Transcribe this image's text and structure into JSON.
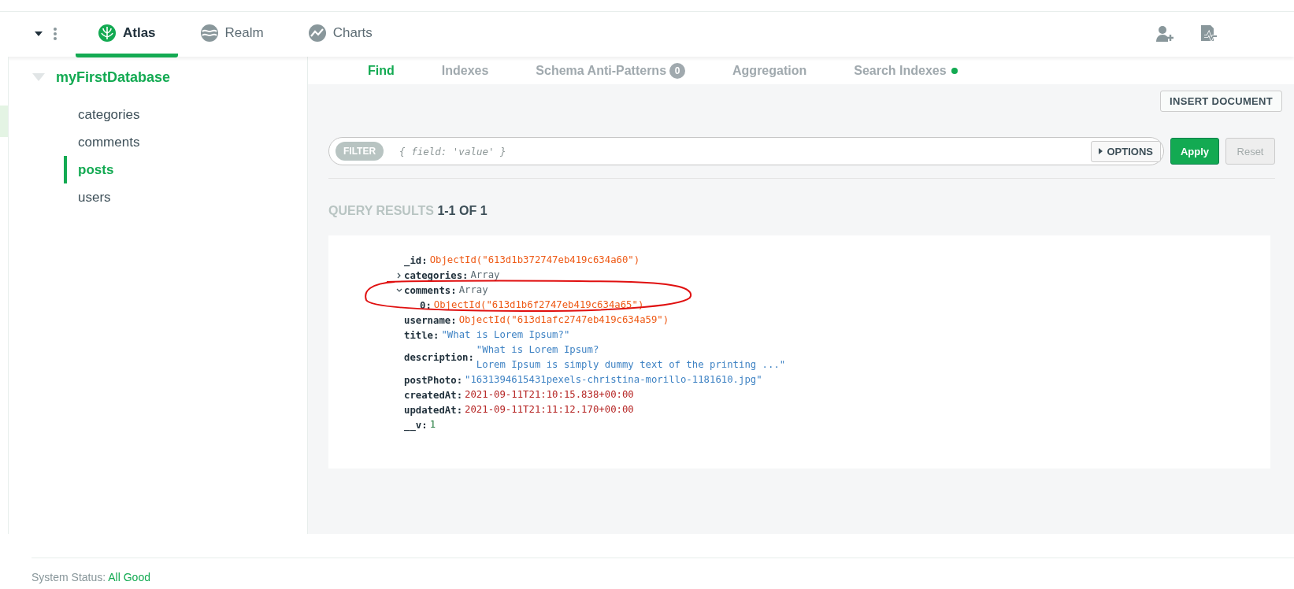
{
  "top_nav": {
    "tabs": [
      {
        "label": "Atlas",
        "selected": true
      },
      {
        "label": "Realm",
        "selected": false
      },
      {
        "label": "Charts",
        "selected": false
      }
    ]
  },
  "sidebar": {
    "database": {
      "name": "myFirstDatabase",
      "expanded": true
    },
    "collections": [
      {
        "label": "categories",
        "selected": false
      },
      {
        "label": "comments",
        "selected": false
      },
      {
        "label": "posts",
        "selected": true
      },
      {
        "label": "users",
        "selected": false
      }
    ]
  },
  "collection_tabs": [
    {
      "label": "Find",
      "selected": true
    },
    {
      "label": "Indexes",
      "selected": false
    },
    {
      "label": "Schema Anti-Patterns",
      "selected": false,
      "count": "0"
    },
    {
      "label": "Aggregation",
      "selected": false
    },
    {
      "label": "Search Indexes",
      "selected": false,
      "color": "#13aa52"
    }
  ],
  "insert_button": "INSERT DOCUMENT",
  "filter": {
    "label": "FILTER",
    "placeholder": "{ field: 'value' }",
    "options": "OPTIONS",
    "apply": "Apply",
    "reset": "Reset",
    "reset_disabled": true
  },
  "results": {
    "label": "QUERY RESULTS",
    "range": "1-1 OF 1"
  },
  "document": {
    "fields": [
      {
        "key": "_id:",
        "kind": "objectid",
        "value": "ObjectId(\"613d1b372747eb419c634a60\")"
      },
      {
        "key": "categories:",
        "kind": "array",
        "value": "Array",
        "expanded": false
      },
      {
        "key": "comments:",
        "kind": "array",
        "value": "Array",
        "expanded": true,
        "children": [
          {
            "key": "0:",
            "kind": "objectid",
            "value": "ObjectId(\"613d1b6f2747eb419c634a65\")"
          }
        ]
      },
      {
        "key": "username:",
        "kind": "objectid",
        "value": "ObjectId(\"613d1afc2747eb419c634a59\")"
      },
      {
        "key": "title:",
        "kind": "string",
        "value": "\"What is Lorem Ipsum?\""
      },
      {
        "key": "description:",
        "kind": "string",
        "value": "\"What is Lorem Ipsum?\nLorem Ipsum is simply dummy text of the printing ...\""
      },
      {
        "key": "postPhoto:",
        "kind": "string",
        "value": "\"1631394615431pexels-christina-morillo-1181610.jpg\""
      },
      {
        "key": "createdAt:",
        "kind": "date",
        "value": "2021-09-11T21:10:15.838+00:00"
      },
      {
        "key": "updatedAt:",
        "kind": "date",
        "value": "2021-09-11T21:11:12.170+00:00"
      },
      {
        "key": "__v:",
        "kind": "number",
        "value": "1"
      }
    ]
  },
  "status_bar": {
    "label": "System Status:",
    "value": "All Good"
  }
}
